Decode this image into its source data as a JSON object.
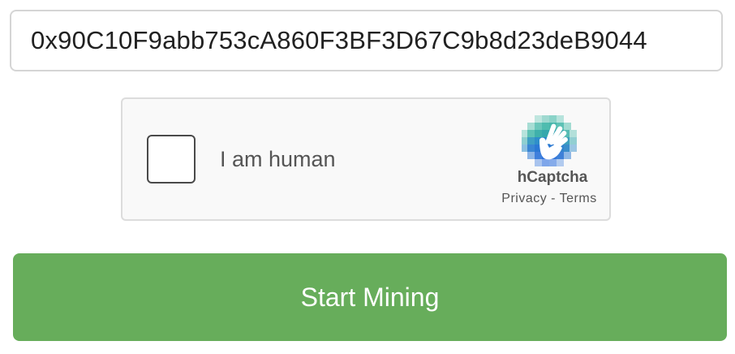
{
  "address_input": {
    "value": "0x90C10F9abb753cA860F3BF3D67C9b8d23deB9044"
  },
  "captcha": {
    "label": "I am human",
    "brand": "hCaptcha",
    "privacy_link": "Privacy",
    "separator": " - ",
    "terms_link": "Terms",
    "logo_icon": "hcaptcha-hand-icon"
  },
  "start_button": {
    "label": "Start Mining",
    "color": "#67ad5b"
  }
}
